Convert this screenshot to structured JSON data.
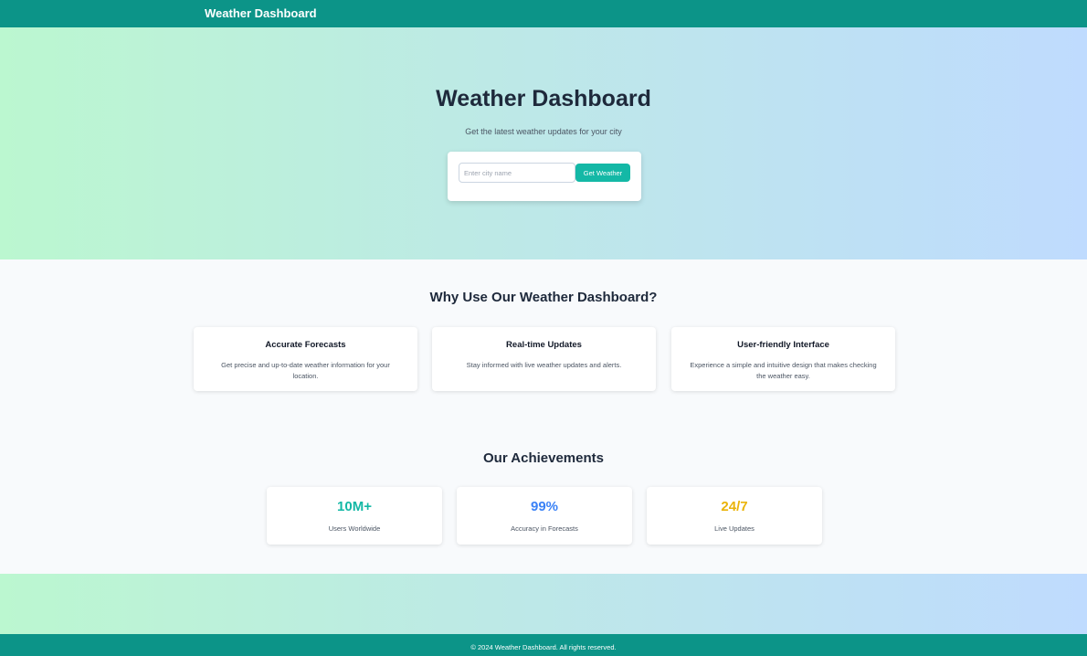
{
  "header": {
    "brand": "Weather Dashboard"
  },
  "hero": {
    "title": "Weather Dashboard",
    "subtitle": "Get the latest weather updates for your city",
    "search": {
      "placeholder": "Enter city name",
      "value": "",
      "button_label": "Get Weather"
    }
  },
  "features": {
    "title": "Why Use Our Weather Dashboard?",
    "items": [
      {
        "title": "Accurate Forecasts",
        "description": "Get precise and up-to-date weather information for your location."
      },
      {
        "title": "Real-time Updates",
        "description": "Stay informed with live weather updates and alerts."
      },
      {
        "title": "User-friendly Interface",
        "description": "Experience a simple and intuitive design that makes checking the weather easy."
      }
    ]
  },
  "achievements": {
    "title": "Our Achievements",
    "items": [
      {
        "value": "10M+",
        "label": "Users Worldwide",
        "color": "#14b8a6"
      },
      {
        "value": "99%",
        "label": "Accuracy in Forecasts",
        "color": "#3b82f6"
      },
      {
        "value": "24/7",
        "label": "Live Updates",
        "color": "#eab308"
      }
    ]
  },
  "footer": {
    "text": "© 2024 Weather Dashboard. All rights reserved."
  },
  "colors": {
    "primary": "#0c9488",
    "accent": "#14b8a6",
    "gradient_start": "#bbf7d0",
    "gradient_end": "#bfdbfe"
  }
}
